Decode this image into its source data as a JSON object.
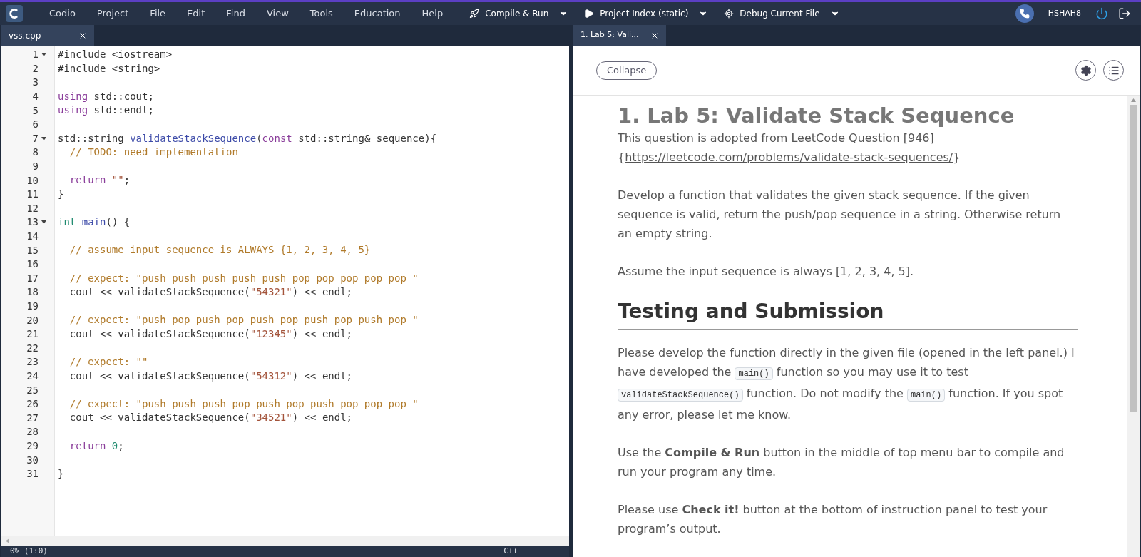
{
  "menu_bar": {
    "items": [
      "Codio",
      "Project",
      "File",
      "Edit",
      "Find",
      "View",
      "Tools",
      "Education",
      "Help"
    ],
    "actions": [
      {
        "kind": "rocket",
        "label": "Compile & Run"
      },
      {
        "kind": "play",
        "label": "Project Index (static)"
      },
      {
        "kind": "target",
        "label": "Debug Current File"
      }
    ],
    "user": "HSHAH8"
  },
  "editor": {
    "tabs": [
      {
        "label": "vss.cpp",
        "selected": true
      }
    ],
    "lines": [
      {
        "n": "1",
        "fold": true,
        "tokens": [
          {
            "kind": "plain",
            "t": "#include <iostream>"
          }
        ]
      },
      {
        "n": "2",
        "fold": false,
        "tokens": [
          {
            "kind": "plain",
            "t": "#include <string>"
          }
        ]
      },
      {
        "n": "3",
        "fold": false
      },
      {
        "n": "4",
        "fold": false,
        "tokens": [
          {
            "kind": "keyword",
            "t": "using"
          },
          {
            "kind": "plain",
            "t": " std::cout;"
          }
        ]
      },
      {
        "n": "5",
        "fold": false,
        "tokens": [
          {
            "kind": "keyword",
            "t": "using"
          },
          {
            "kind": "plain",
            "t": " std::endl;"
          }
        ]
      },
      {
        "n": "6",
        "fold": false
      },
      {
        "n": "7",
        "fold": true,
        "tokens": [
          {
            "kind": "plain",
            "t": "std::string "
          },
          {
            "kind": "function",
            "t": "validateStackSequence"
          },
          {
            "kind": "plain",
            "t": "("
          },
          {
            "kind": "keyword",
            "t": "const"
          },
          {
            "kind": "plain",
            "t": " std::string& sequence){"
          }
        ]
      },
      {
        "n": "8",
        "fold": false,
        "tokens": [
          {
            "kind": "comment",
            "t": "  // TODO: need implementation"
          }
        ]
      },
      {
        "n": "9",
        "fold": false
      },
      {
        "n": "10",
        "fold": false,
        "tokens": [
          {
            "kind": "keyword",
            "t": "  return"
          },
          {
            "kind": "string",
            "t": " \"\""
          },
          {
            "kind": "plain",
            "t": ";"
          }
        ]
      },
      {
        "n": "11",
        "fold": false,
        "tokens": [
          {
            "kind": "plain",
            "t": "}"
          }
        ]
      },
      {
        "n": "12",
        "fold": false
      },
      {
        "n": "13",
        "fold": true,
        "tokens": [
          {
            "kind": "type",
            "t": "int"
          },
          {
            "kind": "function",
            "t": " main"
          },
          {
            "kind": "plain",
            "t": "() {"
          }
        ]
      },
      {
        "n": "14",
        "fold": false
      },
      {
        "n": "15",
        "fold": false,
        "tokens": [
          {
            "kind": "comment",
            "t": "  // assume input sequence is ALWAYS {1, 2, 3, 4, 5}"
          }
        ]
      },
      {
        "n": "16",
        "fold": false
      },
      {
        "n": "17",
        "fold": false,
        "tokens": [
          {
            "kind": "comment",
            "t": "  // expect: \"push push push push push pop pop pop pop pop \""
          }
        ]
      },
      {
        "n": "18",
        "fold": false,
        "tokens": [
          {
            "kind": "plain",
            "t": "  cout << validateStackSequence("
          },
          {
            "kind": "string",
            "t": "\"54321\""
          },
          {
            "kind": "plain",
            "t": ") << endl;"
          }
        ]
      },
      {
        "n": "19",
        "fold": false
      },
      {
        "n": "20",
        "fold": false,
        "tokens": [
          {
            "kind": "comment",
            "t": "  // expect: \"push pop push pop push pop push pop push pop \""
          }
        ]
      },
      {
        "n": "21",
        "fold": false,
        "tokens": [
          {
            "kind": "plain",
            "t": "  cout << validateStackSequence("
          },
          {
            "kind": "string",
            "t": "\"12345\""
          },
          {
            "kind": "plain",
            "t": ") << endl;"
          }
        ]
      },
      {
        "n": "22",
        "fold": false
      },
      {
        "n": "23",
        "fold": false,
        "tokens": [
          {
            "kind": "comment",
            "t": "  // expect: \"\""
          }
        ]
      },
      {
        "n": "24",
        "fold": false,
        "tokens": [
          {
            "kind": "plain",
            "t": "  cout << validateStackSequence("
          },
          {
            "kind": "string",
            "t": "\"54312\""
          },
          {
            "kind": "plain",
            "t": ") << endl;"
          }
        ]
      },
      {
        "n": "25",
        "fold": false
      },
      {
        "n": "26",
        "fold": false,
        "tokens": [
          {
            "kind": "comment",
            "t": "  // expect: \"push push push pop push pop push pop pop pop \""
          }
        ]
      },
      {
        "n": "27",
        "fold": false,
        "tokens": [
          {
            "kind": "plain",
            "t": "  cout << validateStackSequence("
          },
          {
            "kind": "string",
            "t": "\"34521\""
          },
          {
            "kind": "plain",
            "t": ") << endl;"
          }
        ]
      },
      {
        "n": "28",
        "fold": false
      },
      {
        "n": "29",
        "fold": false,
        "tokens": [
          {
            "kind": "keyword",
            "t": "  return"
          },
          {
            "kind": "number",
            "t": " 0"
          },
          {
            "kind": "plain",
            "t": ";"
          }
        ]
      },
      {
        "n": "30",
        "fold": false
      },
      {
        "n": "31",
        "fold": false,
        "tokens": [
          {
            "kind": "plain",
            "t": "}"
          }
        ]
      }
    ],
    "status_bar": {
      "position": "0% (1:0)",
      "language": "C++"
    }
  },
  "guide": {
    "tabs": [
      {
        "label": "1. Lab 5: Vali...",
        "selected": true
      }
    ],
    "collapse_button": "Collapse",
    "title": "1. Lab 5: Validate Stack Sequence",
    "intro": [
      {
        "kind": "text",
        "t": "This question is adopted from LeetCode Question [946] {"
      },
      {
        "kind": "link",
        "t": "https://leetcode.com/problems/validate-stack-sequences/"
      },
      {
        "kind": "text",
        "t": "}"
      }
    ],
    "paragraphs": [
      [
        {
          "kind": "text",
          "t": "Develop a function that validates the given stack sequence. If the given sequence is valid, return the push/pop sequence in a string. Otherwise return an empty string."
        }
      ],
      [
        {
          "kind": "text",
          "t": "Assume the input sequence is always [1, 2, 3, 4, 5]."
        }
      ]
    ],
    "section_heading": "Testing and Submission",
    "section_paragraphs": [
      [
        {
          "kind": "text",
          "t": "Please develop the function directly in the given file (opened in the left panel.) I have developed the "
        },
        {
          "kind": "code",
          "t": "main()"
        },
        {
          "kind": "text",
          "t": " function so you may use it to test "
        },
        {
          "kind": "code",
          "t": "validateStackSequence()"
        },
        {
          "kind": "text",
          "t": " function. Do not modify the "
        },
        {
          "kind": "code",
          "t": "main()"
        },
        {
          "kind": "text",
          "t": " function. If you spot any error, please let me know."
        }
      ],
      [
        {
          "kind": "text",
          "t": "Use the **Compile & Run** button in the middle of top menu bar to compile and run your program any time."
        }
      ],
      [
        {
          "kind": "text",
          "t": "Please use **Check it!** button at the bottom of instruction panel to test your program’s output."
        }
      ]
    ]
  }
}
